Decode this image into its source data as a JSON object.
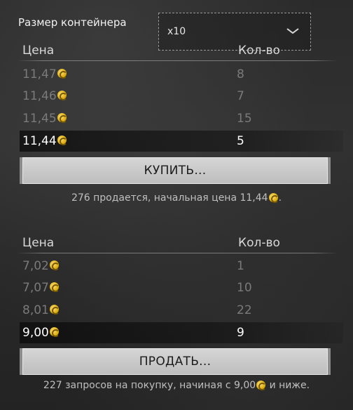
{
  "container": {
    "label": "Размер контейнера",
    "selected": "x10"
  },
  "buy": {
    "headers": {
      "price": "Цена",
      "qty": "Кол-во"
    },
    "rows": [
      {
        "price": "11,47",
        "qty": "8"
      },
      {
        "price": "11,46",
        "qty": "7"
      },
      {
        "price": "11,45",
        "qty": "15"
      },
      {
        "price": "11,44",
        "qty": "5"
      }
    ],
    "button_label": "КУПИТЬ...",
    "note_prefix": "276 продается, начальная цена 11,44",
    "note_suffix": "."
  },
  "sell": {
    "headers": {
      "price": "Цена",
      "qty": "Кол-во"
    },
    "rows": [
      {
        "price": "7,02",
        "qty": "1"
      },
      {
        "price": "7,07",
        "qty": "10"
      },
      {
        "price": "8,01",
        "qty": "22"
      },
      {
        "price": "9,00",
        "qty": "9"
      }
    ],
    "button_label": "ПРОДАТЬ...",
    "note_prefix": "227 запросов на покупку, начиная с 9,00",
    "note_suffix": " и ниже."
  },
  "colors": {
    "coin": "#e0b000",
    "button": "#c9c9c9"
  },
  "icons": {
    "currency": "coin-icon",
    "dropdown": "chevron-down-icon"
  }
}
